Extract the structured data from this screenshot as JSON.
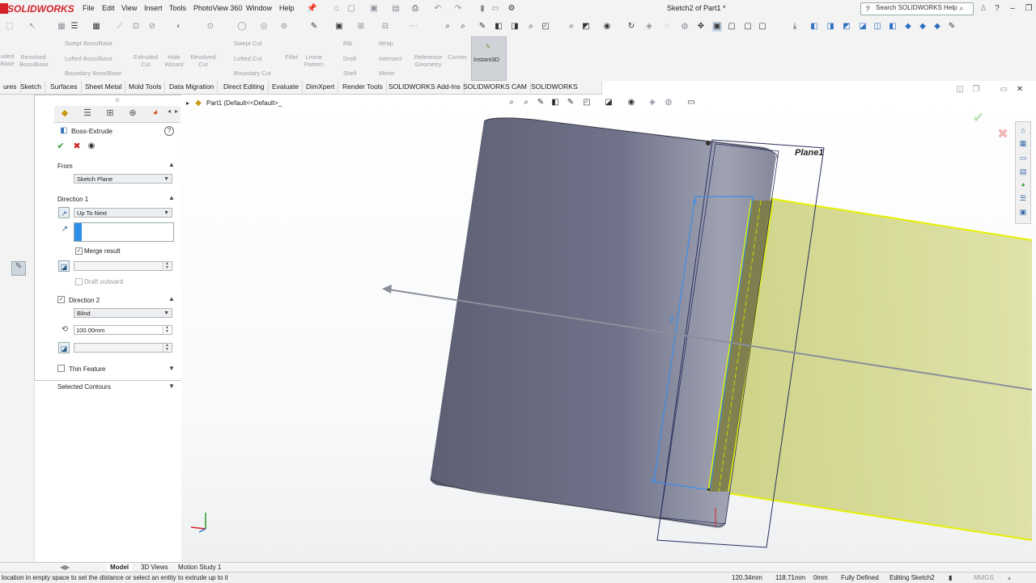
{
  "app": {
    "logo": "SOLIDWORKS",
    "document_title": "Sketch2 of Part1 *"
  },
  "menu": [
    "File",
    "Edit",
    "View",
    "Insert",
    "Tools",
    "PhotoView 360",
    "Window",
    "Help"
  ],
  "search": {
    "placeholder": "Search SOLIDWORKS Help"
  },
  "command_manager": {
    "left_cut": [
      "uded",
      "Base"
    ],
    "revolved_boss": "Revolved Boss/Base",
    "swept_boss": "Swept Boss/Base",
    "lofted_boss": "Lofted Boss/Base",
    "boundary_boss": "Boundary Boss/Base",
    "extruded_cut": "Extruded Cut",
    "hole_wizard": "Hole Wizard",
    "revolved_cut": "Revolved Cut",
    "swept_cut": "Swept Cut",
    "lofted_cut": "Lofted Cut",
    "boundary_cut": "Boundary Cut",
    "fillet": "Fillet",
    "linear_pattern": "Linear Pattern",
    "rib": "Rib",
    "draft": "Draft",
    "shell": "Shell",
    "wrap": "Wrap",
    "intersect": "Intersect",
    "mirror": "Mirror",
    "reference_geometry": "Reference Geometry",
    "curves": "Curves",
    "instant3d": "Instant3D"
  },
  "tabs": [
    "ures",
    "Sketch",
    "Surfaces",
    "Sheet Metal",
    "Mold Tools",
    "Data Migration",
    "Direct Editing",
    "Evaluate",
    "DimXpert",
    "Render Tools",
    "SOLIDWORKS Add-Ins",
    "SOLIDWORKS CAM",
    "SOLIDWORKS Visualize"
  ],
  "tree": {
    "part_label": "Part1  (Default<<Default>_"
  },
  "property_manager": {
    "title": "Boss-Extrude",
    "from_label": "From",
    "from_value": "Sketch Plane",
    "direction1_label": "Direction 1",
    "direction1_end": "Up To Next",
    "direction1_ref": "",
    "merge_result": "Merge result",
    "draft_outward": "Draft outward",
    "direction2_label": "Direction 2",
    "direction2_end": "Blind",
    "direction2_depth": "100.00mm",
    "thin_feature": "Thin Feature",
    "selected_contours": "Selected Contours"
  },
  "viewport": {
    "plane_label": "Plane1"
  },
  "bottom_tabs": [
    "Model",
    "3D Views",
    "Motion Study 1"
  ],
  "status": {
    "hint": "location in empty space to set the distance or select an entity to extrude up to it",
    "x": "120.34mm",
    "y": "118.71mm",
    "z": "0mm",
    "definition": "Fully Defined",
    "mode": "Editing Sketch2",
    "units": "MMGS"
  },
  "colors": {
    "accent_red": "#d6232a",
    "cylinder": "#6c6e80",
    "plane_fill": "#d6d98a",
    "plane_edge": "#e6f000",
    "sketch_blue": "#3b8ee8"
  }
}
